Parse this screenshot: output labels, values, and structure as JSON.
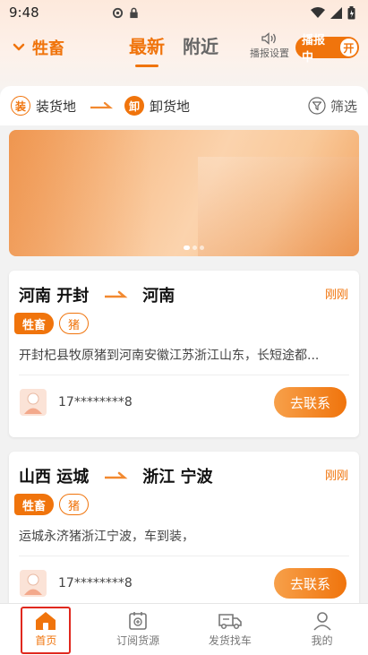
{
  "status_bar": {
    "time": "9:48"
  },
  "header": {
    "category_label": "牲畜",
    "tabs": [
      {
        "label": "最新",
        "active": true
      },
      {
        "label": "附近",
        "active": false
      }
    ],
    "broadcast_setting_label": "播报设置",
    "broadcast_status_label": "播报中",
    "broadcast_toggle_label": "开"
  },
  "filter_bar": {
    "load_badge": "装",
    "load_label": "装货地",
    "unload_badge": "卸",
    "unload_label": "卸货地",
    "filter_label": "筛选"
  },
  "banner": {
    "page_count": 3,
    "active_index": 0
  },
  "listings": [
    {
      "from": "河南 开封",
      "to": "河南",
      "time": "刚刚",
      "tags": [
        "牲畜",
        "猪"
      ],
      "description": "开封杞县牧原猪到河南安徽江苏浙江山东，长短途都...",
      "phone": "17********8",
      "contact_label": "去联系"
    },
    {
      "from": "山西 运城",
      "to": "浙江 宁波",
      "time": "刚刚",
      "tags": [
        "牲畜",
        "猪"
      ],
      "description": "运城永济猪浙江宁波，车到装，",
      "phone": "17********8",
      "contact_label": "去联系"
    }
  ],
  "bottom_nav": [
    {
      "label": "首页",
      "icon": "home-icon",
      "active": true
    },
    {
      "label": "订阅货源",
      "icon": "subscribe-icon",
      "active": false
    },
    {
      "label": "发货找车",
      "icon": "truck-icon",
      "active": false
    },
    {
      "label": "我的",
      "icon": "user-icon",
      "active": false
    }
  ],
  "colors": {
    "accent": "#f0740c",
    "highlight": "#e0281e"
  }
}
